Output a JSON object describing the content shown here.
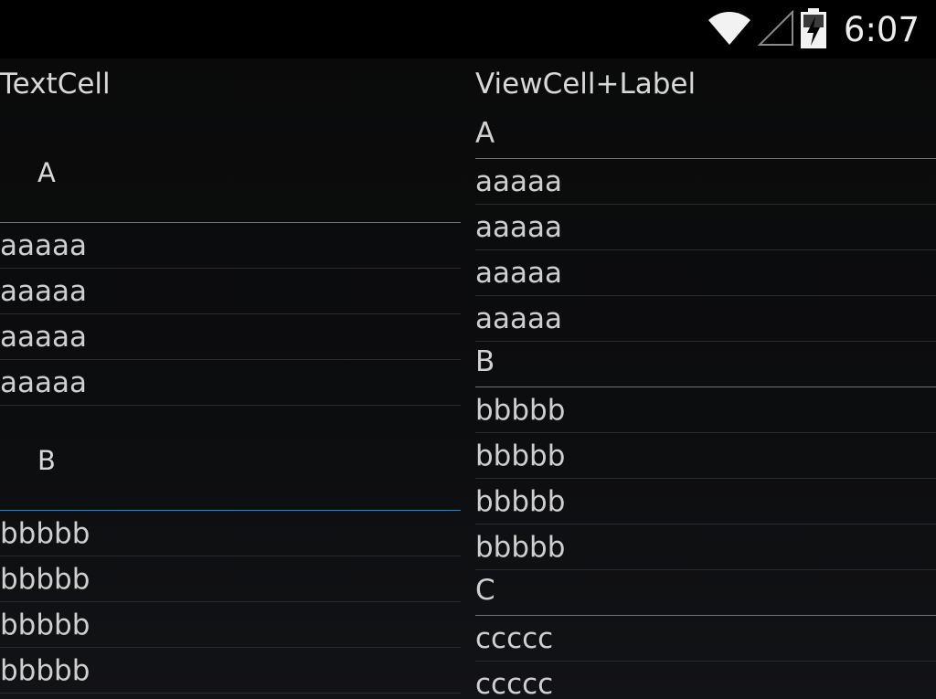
{
  "status_bar": {
    "time": "6:07",
    "wifi_icon": "wifi-icon",
    "signal_icon": "cell-signal-icon",
    "battery_icon": "battery-charging-icon"
  },
  "left_pane": {
    "title": "TextCell",
    "groups": [
      {
        "header": "A",
        "items": [
          "aaaaa",
          "aaaaa",
          "aaaaa",
          "aaaaa"
        ]
      },
      {
        "header": "B",
        "items": [
          "bbbbb",
          "bbbbb",
          "bbbbb",
          "bbbbb"
        ]
      }
    ]
  },
  "right_pane": {
    "title": "ViewCell+Label",
    "groups": [
      {
        "header": "A",
        "items": [
          "aaaaa",
          "aaaaa",
          "aaaaa",
          "aaaaa"
        ]
      },
      {
        "header": "B",
        "items": [
          "bbbbb",
          "bbbbb",
          "bbbbb",
          "bbbbb"
        ]
      },
      {
        "header": "C",
        "items": [
          "ccccc",
          "ccccc"
        ]
      }
    ]
  },
  "colors": {
    "separator_accent": "#3b83a8",
    "background": "#0b0c0e",
    "text": "#cfcfcf"
  }
}
